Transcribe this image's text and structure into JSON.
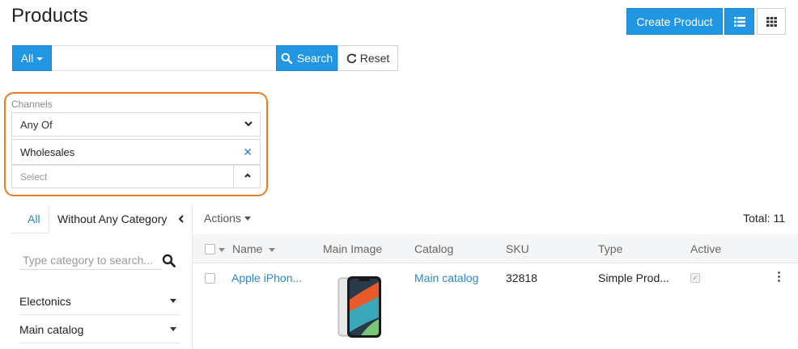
{
  "header": {
    "title": "Products",
    "create_label": "Create Product",
    "list_view_icon": "list-icon",
    "grid_view_icon": "grid-icon"
  },
  "search": {
    "scope_label": "All",
    "value": "",
    "placeholder": "",
    "search_label": "Search",
    "reset_label": "Reset"
  },
  "filter": {
    "label": "Channels",
    "condition": "Any Of",
    "selected_tag": "Wholesales",
    "select_placeholder": "Select",
    "highlight_color": "#f07a1e"
  },
  "categories": {
    "tab_all": "All",
    "tab_without": "Without Any Category",
    "search_placeholder": "Type category to search...",
    "items": [
      "Electonics",
      "Main catalog"
    ]
  },
  "toolbar": {
    "actions_label": "Actions",
    "total_label": "Total: 11"
  },
  "table": {
    "columns": [
      "Name",
      "Main Image",
      "Catalog",
      "SKU",
      "Type",
      "Active"
    ],
    "rows": [
      {
        "name": "Apple iPhon...",
        "image_icon": "phone-image",
        "catalog": "Main catalog",
        "sku": "32818",
        "type": "Simple Prod...",
        "active": true
      }
    ]
  },
  "colors": {
    "primary": "#2196e3",
    "link": "#2e86c9"
  }
}
